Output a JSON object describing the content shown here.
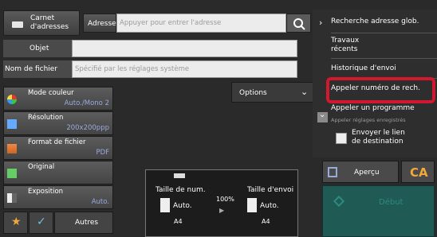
{
  "top": {
    "address_book": "Carnet\nd'adresses",
    "address_label": "Adresse",
    "address_placeholder": "Appuyer pour entrer l'adresse",
    "subject_label": "Objet",
    "filename_label": "Nom de fichier",
    "filename_placeholder": "Spécifié par les réglages système"
  },
  "options": {
    "label": "Options"
  },
  "side": [
    {
      "title": "Mode couleur",
      "value": "Auto./Mono 2"
    },
    {
      "title": "Résolution",
      "value": "200x200ppp"
    },
    {
      "title": "Format de fichier",
      "value": "PDF"
    },
    {
      "title": "Original",
      "value": ""
    },
    {
      "title": "Exposition",
      "value": "Auto."
    }
  ],
  "bottom": {
    "others": "Autres"
  },
  "preview": {
    "scan_size_label": "Taille de num.",
    "send_size_label": "Taille d'envoi",
    "ratio": "100%",
    "scan_value": "Auto.",
    "send_value": "Auto.",
    "scan_paper": "A4",
    "send_paper": "A4"
  },
  "menu": {
    "items": [
      "Recherche adresse glob.",
      "Travaux\nrécents",
      "Historique d'envoi",
      "Appeler numéro de rech.",
      "Appeler un programme",
      "Appeler réglages enregistrés"
    ],
    "send_link": "Envoyer le lien\nde destination"
  },
  "actions": {
    "preview": "Aperçu",
    "ca": "CA",
    "start": "Début"
  },
  "colors": {
    "highlight": "#d2182f",
    "accent": "#f2a93b"
  }
}
